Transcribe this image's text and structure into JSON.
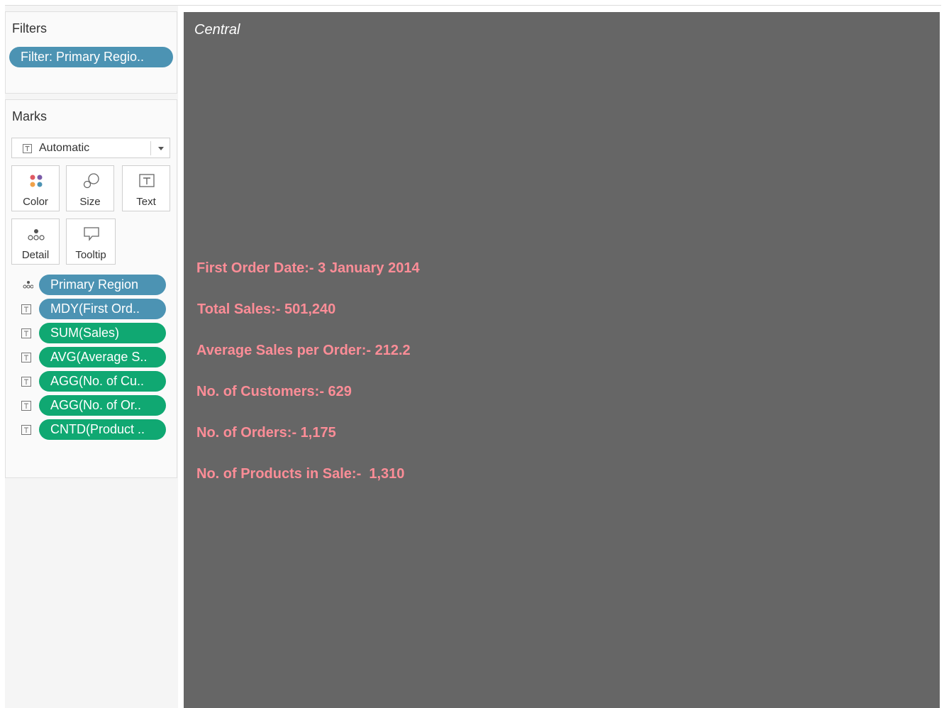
{
  "filters": {
    "title": "Filters",
    "pill": "Filter: Primary Regio.."
  },
  "marks": {
    "title": "Marks",
    "type_dropdown": "Automatic",
    "buttons": {
      "color": "Color",
      "size": "Size",
      "text": "Text",
      "detail": "Detail",
      "tooltip": "Tooltip"
    },
    "fields": [
      {
        "label": "Primary Region",
        "kind": "detail",
        "color": "#4c93b3"
      },
      {
        "label": "MDY(First Ord..",
        "kind": "text",
        "color": "#4c93b3"
      },
      {
        "label": "SUM(Sales)",
        "kind": "text",
        "color": "#10a872"
      },
      {
        "label": "AVG(Average S..",
        "kind": "text",
        "color": "#10a872"
      },
      {
        "label": "AGG(No. of Cu..",
        "kind": "text",
        "color": "#10a872"
      },
      {
        "label": "AGG(No. of Or..",
        "kind": "text",
        "color": "#10a872"
      },
      {
        "label": "CNTD(Product ..",
        "kind": "text",
        "color": "#10a872"
      }
    ]
  },
  "view": {
    "title": "Central",
    "background": "#666666",
    "text_color": "#fc8d97",
    "stats": [
      "First Order Date:- 3 January 2014",
      "Total Sales:- 501,240",
      "Average Sales per Order:- 212.2",
      "No. of Customers:- 629",
      "No. of Orders:- 1,175",
      "No. of Products in Sale:-  1,310"
    ]
  }
}
